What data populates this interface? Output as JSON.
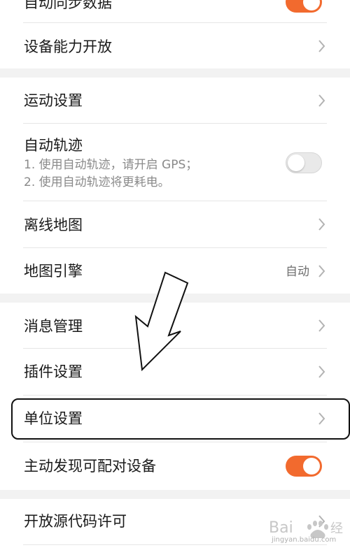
{
  "rows": {
    "auto_sync": {
      "label": "自动同步数据",
      "toggle": "on"
    },
    "device_capability": {
      "label": "设备能力开放"
    },
    "sport_settings": {
      "label": "运动设置"
    },
    "auto_track": {
      "label": "自动轨迹",
      "line1": "1. 使用自动轨迹，请开启 GPS；",
      "line2": "2. 使用自动轨迹将更耗电。",
      "toggle": "off"
    },
    "offline_map": {
      "label": "离线地图"
    },
    "map_engine": {
      "label": "地图引擎",
      "value": "自动"
    },
    "message_mgmt": {
      "label": "消息管理"
    },
    "plugin_settings": {
      "label": "插件设置"
    },
    "unit_settings": {
      "label": "单位设置"
    },
    "discover_pair": {
      "label": "主动发现可配对设备",
      "toggle": "on"
    },
    "open_source": {
      "label": "开放源代码许可"
    }
  },
  "watermark": {
    "brand": "Bai",
    "sub": "jingyan.baidu.com"
  },
  "colors": {
    "accent": "#f26a2e",
    "background": "#f2f2f2",
    "card": "#ffffff"
  }
}
